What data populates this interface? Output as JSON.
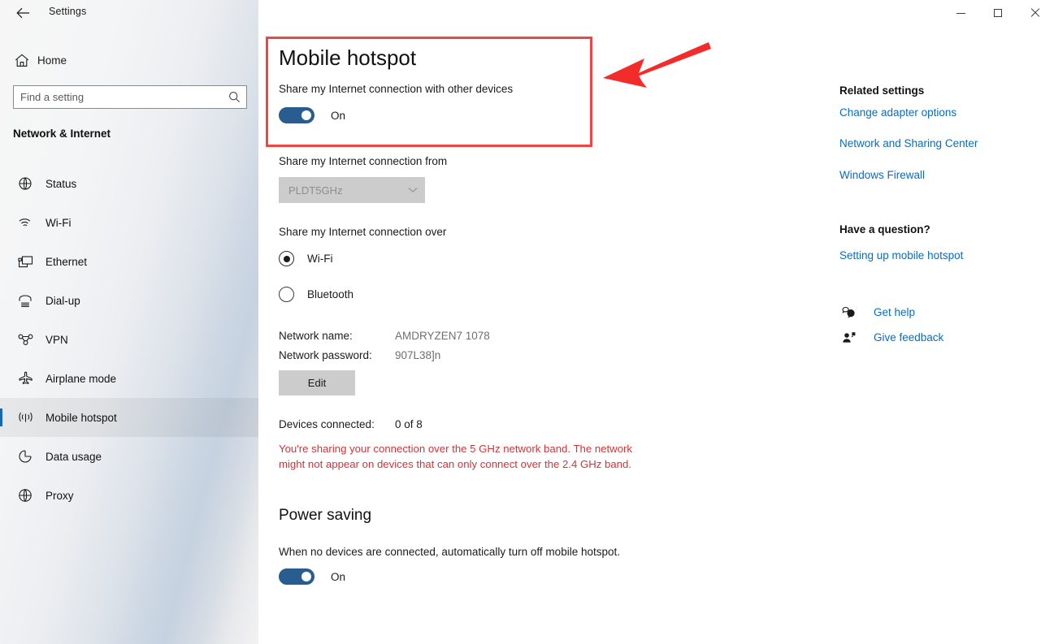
{
  "window": {
    "title": "Settings",
    "back_icon": "back-arrow-icon",
    "minimize_label": "Minimize",
    "maximize_label": "Maximize",
    "close_label": "Close"
  },
  "sidebar": {
    "home": {
      "label": "Home",
      "icon": "home-icon"
    },
    "search": {
      "placeholder": "Find a setting",
      "value": "",
      "icon": "search-icon"
    },
    "heading": "Network & Internet",
    "items": [
      {
        "label": "Status",
        "icon": "status-icon",
        "selected": false
      },
      {
        "label": "Wi-Fi",
        "icon": "wifi-icon",
        "selected": false
      },
      {
        "label": "Ethernet",
        "icon": "ethernet-icon",
        "selected": false
      },
      {
        "label": "Dial-up",
        "icon": "dialup-icon",
        "selected": false
      },
      {
        "label": "VPN",
        "icon": "vpn-icon",
        "selected": false
      },
      {
        "label": "Airplane mode",
        "icon": "airplane-icon",
        "selected": false
      },
      {
        "label": "Mobile hotspot",
        "icon": "hotspot-icon",
        "selected": true
      },
      {
        "label": "Data usage",
        "icon": "data-usage-icon",
        "selected": false
      },
      {
        "label": "Proxy",
        "icon": "proxy-icon",
        "selected": false
      }
    ]
  },
  "main": {
    "page_title": "Mobile hotspot",
    "share_label": "Share my Internet connection with other devices",
    "share_toggle_state": "On",
    "from_label": "Share my Internet connection from",
    "from_value": "PLDT5GHz",
    "over_label": "Share my Internet connection over",
    "radio_wifi": "Wi-Fi",
    "radio_bluetooth": "Bluetooth",
    "network_name_label": "Network name:",
    "network_name_value": "AMDRYZEN7 1078",
    "network_password_label": "Network password:",
    "network_password_value": "907L38]n",
    "edit_button": "Edit",
    "devices_label": "Devices connected:",
    "devices_value": "0 of 8",
    "warning": "You're sharing your connection over the 5 GHz network band. The network might not appear on devices that can only connect over the 2.4 GHz band.",
    "power_title": "Power saving",
    "power_sub": "When no devices are connected, automatically turn off mobile hotspot.",
    "power_toggle_state": "On"
  },
  "rail": {
    "related_heading": "Related settings",
    "links": [
      "Change adapter options",
      "Network and Sharing Center",
      "Windows Firewall"
    ],
    "question_heading": "Have a question?",
    "question_link": "Setting up mobile hotspot",
    "get_help": "Get help",
    "give_feedback": "Give feedback"
  },
  "colors": {
    "accent": "#0a6cbc",
    "toggle_on": "#2a5d8f",
    "warning": "#d13438",
    "annotation": "#f04545",
    "selected_bar": "#1668b3"
  }
}
